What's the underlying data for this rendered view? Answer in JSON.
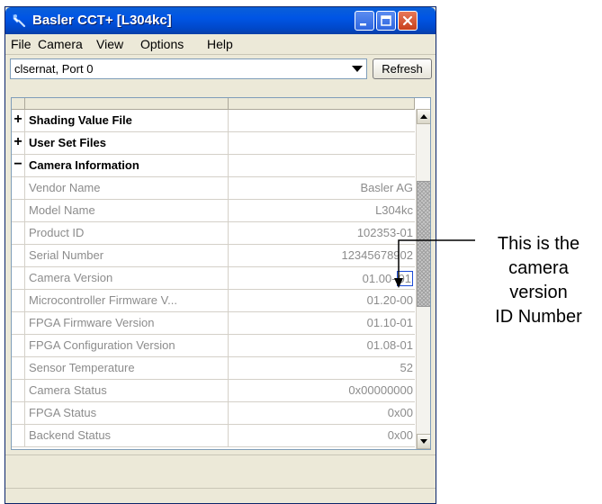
{
  "window": {
    "title": "Basler CCT+ [L304kc]"
  },
  "menu": {
    "file": "File",
    "camera": "Camera",
    "view": "View",
    "options": "Options",
    "help": "Help"
  },
  "port": {
    "selected": "clsernat, Port 0",
    "refresh_label": "Refresh"
  },
  "rows": [
    {
      "kind": "group",
      "toggle": "+",
      "name": "Shading Value File",
      "value": ""
    },
    {
      "kind": "group",
      "toggle": "+",
      "name": "User Set Files",
      "value": ""
    },
    {
      "kind": "group",
      "toggle": "−",
      "name": "Camera Information",
      "value": ""
    },
    {
      "kind": "prop",
      "toggle": "",
      "name": "Vendor Name",
      "value": "Basler AG"
    },
    {
      "kind": "prop",
      "toggle": "",
      "name": "Model Name",
      "value": "L304kc"
    },
    {
      "kind": "prop",
      "toggle": "",
      "name": "Product ID",
      "value": "102353-01"
    },
    {
      "kind": "prop",
      "toggle": "",
      "name": "Serial Number",
      "value": "12345678902"
    },
    {
      "kind": "prop",
      "toggle": "",
      "name": "Camera Version",
      "value": "01.00-",
      "value_highlight": "01"
    },
    {
      "kind": "prop",
      "toggle": "",
      "name": "Microcontroller Firmware V...",
      "value": "01.20-00"
    },
    {
      "kind": "prop",
      "toggle": "",
      "name": "FPGA Firmware Version",
      "value": "01.10-01"
    },
    {
      "kind": "prop",
      "toggle": "",
      "name": "FPGA Configuration Version",
      "value": "01.08-01"
    },
    {
      "kind": "prop",
      "toggle": "",
      "name": "Sensor Temperature",
      "value": "52"
    },
    {
      "kind": "prop",
      "toggle": "",
      "name": "Camera Status",
      "value": "0x00000000"
    },
    {
      "kind": "prop",
      "toggle": "",
      "name": "FPGA Status",
      "value": "0x00"
    },
    {
      "kind": "prop",
      "toggle": "",
      "name": "Backend Status",
      "value": "0x00"
    }
  ],
  "annotation": {
    "line1": "This is the",
    "line2": "camera",
    "line3": "version",
    "line4": "ID Number"
  },
  "icons": {
    "app": "camera-app-icon",
    "minimize": "minimize-icon",
    "maximize": "maximize-icon",
    "close": "close-icon",
    "dropdown": "chevron-down-icon",
    "scroll_up": "scroll-up-arrow-icon",
    "scroll_down": "scroll-down-arrow-icon"
  },
  "colors": {
    "titlebar": "#0055e5",
    "close_button": "#c8401c",
    "highlight_box": "#1c4bd6",
    "dim_text": "#8c8c8c"
  }
}
